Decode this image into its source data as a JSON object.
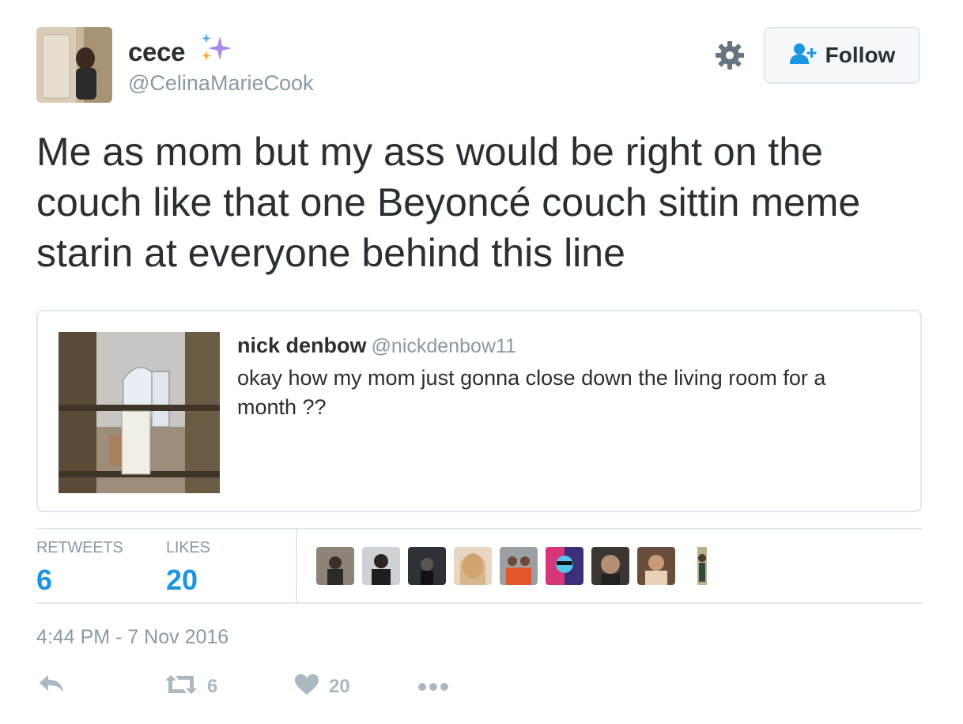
{
  "author": {
    "display_name": "cece",
    "handle": "@CelinaMarieCook",
    "avatar_icon": "user-avatar-photo"
  },
  "header": {
    "follow_label": "Follow",
    "gear_icon": "gear-icon",
    "follow_icon": "follow-user-icon"
  },
  "tweet": {
    "text": "Me as mom but my ass would be right on the couch like that one Beyoncé couch sittin meme starin at everyone behind this line"
  },
  "quoted_tweet": {
    "display_name": "nick denbow",
    "handle": "@nickdenbow11",
    "text": "okay how my mom just gonna close down the living room for a month ??"
  },
  "stats": {
    "retweets_label": "RETWEETS",
    "retweets_value": "6",
    "likes_label": "LIKES",
    "likes_value": "20"
  },
  "timestamp": "4:44 PM - 7 Nov 2016",
  "actions": {
    "reply_icon": "reply-icon",
    "retweet_icon": "retweet-icon",
    "retweet_count": "6",
    "like_icon": "heart-icon",
    "like_count": "20",
    "more_icon": "more-icon"
  },
  "colors": {
    "accent": "#1b95e0",
    "muted": "#8899a6",
    "text": "#292f33",
    "border": "#e1e8ed",
    "action": "#aab8c2"
  }
}
